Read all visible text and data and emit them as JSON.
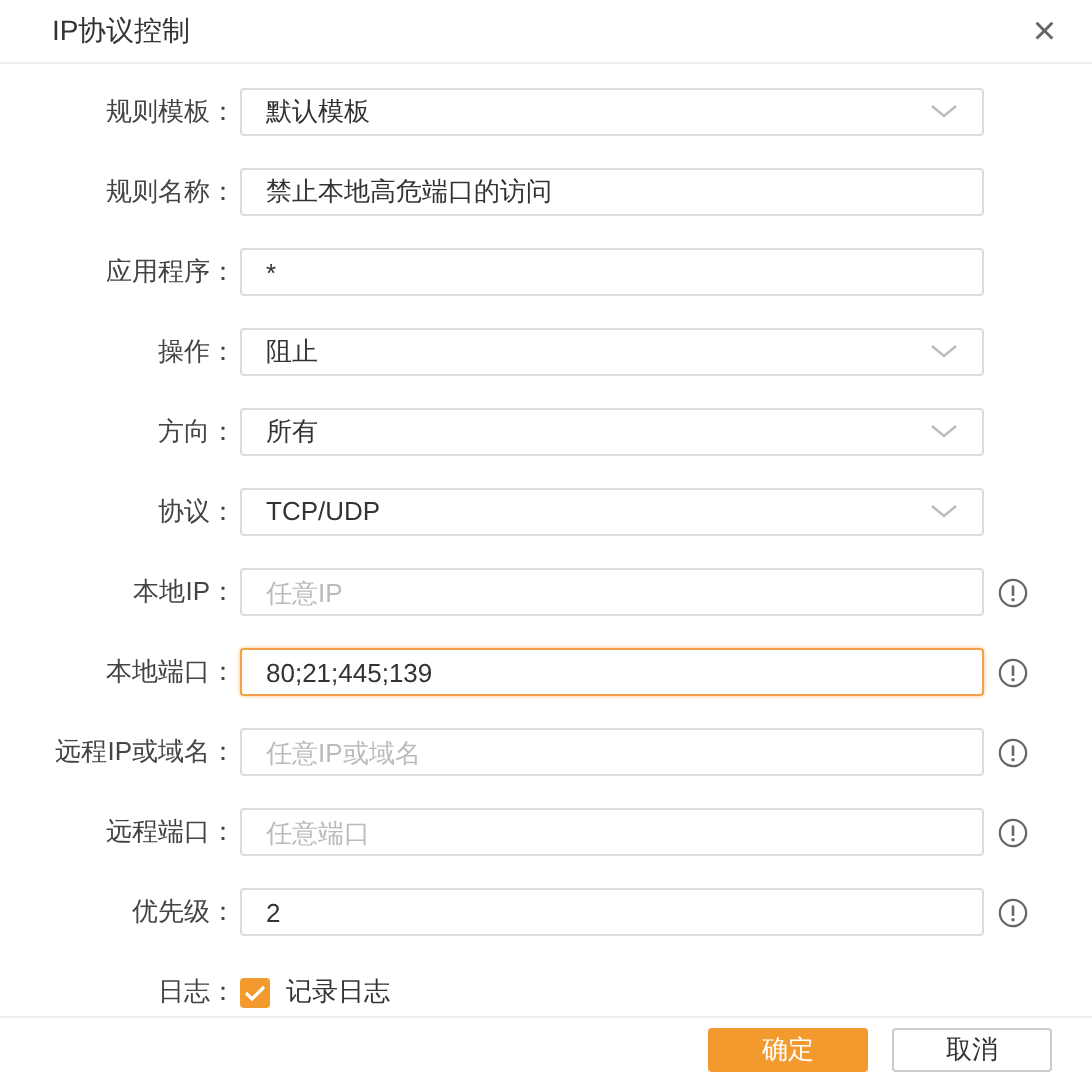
{
  "dialog": {
    "title": "IP协议控制",
    "close": "×"
  },
  "fields": [
    {
      "kind": "select",
      "label": "规则模板：",
      "value": "默认模板"
    },
    {
      "kind": "text",
      "label": "规则名称：",
      "value": "禁止本地高危端口的访问"
    },
    {
      "kind": "text",
      "label": "应用程序：",
      "value": "*"
    },
    {
      "kind": "select",
      "label": "操作：",
      "value": "阻止"
    },
    {
      "kind": "select",
      "label": "方向：",
      "value": "所有"
    },
    {
      "kind": "select",
      "label": "协议：",
      "value": "TCP/UDP"
    },
    {
      "kind": "text",
      "label": "本地IP：",
      "placeholder": "任意IP",
      "info": true
    },
    {
      "kind": "text",
      "label": "本地端口：",
      "value": "80;21;445;139",
      "info": true,
      "focused": true
    },
    {
      "kind": "text",
      "label": "远程IP或域名：",
      "placeholder": "任意IP或域名",
      "info": true
    },
    {
      "kind": "text",
      "label": "远程端口：",
      "placeholder": "任意端口",
      "info": true
    },
    {
      "kind": "text",
      "label": "优先级：",
      "value": "2",
      "info": true
    },
    {
      "kind": "checkbox",
      "label": "日志：",
      "text": "记录日志",
      "checked": true
    }
  ],
  "buttons": [
    {
      "label": "确定",
      "primary": true
    },
    {
      "label": "取消",
      "primary": false
    }
  ]
}
